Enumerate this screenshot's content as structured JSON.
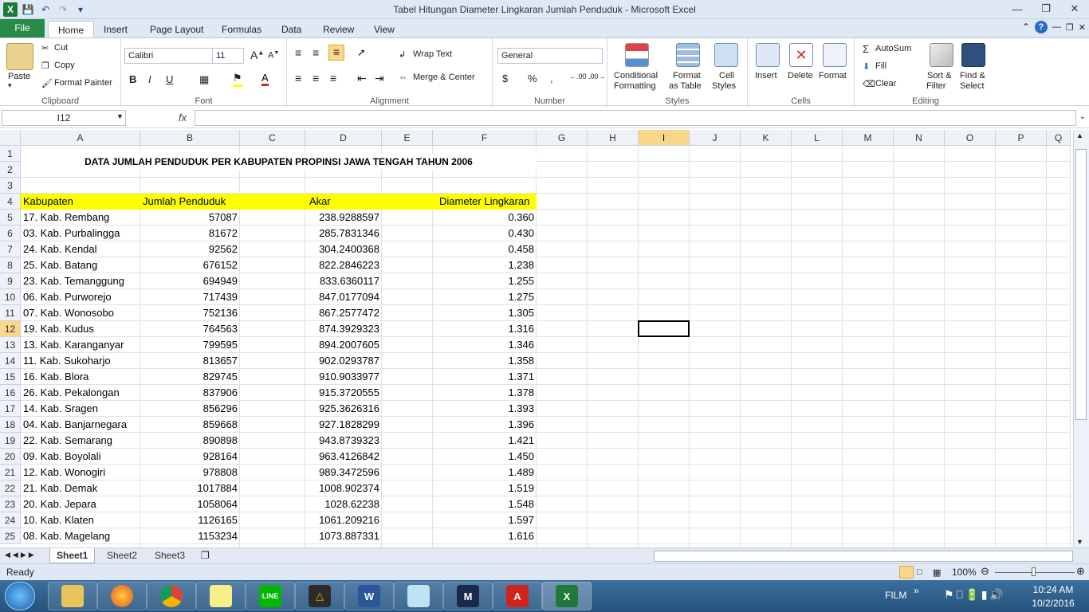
{
  "window": {
    "title": "Tabel Hitungan Diameter Lingkaran Jumlah Penduduk  -  Microsoft Excel"
  },
  "ribbon_tabs": [
    "File",
    "Home",
    "Insert",
    "Page Layout",
    "Formulas",
    "Data",
    "Review",
    "View"
  ],
  "clipboard": {
    "paste": "Paste",
    "cut": "Cut",
    "copy": "Copy",
    "format_painter": "Format Painter",
    "label": "Clipboard"
  },
  "font": {
    "name": "Calibri",
    "size": "11",
    "label": "Font"
  },
  "alignment": {
    "wrap": "Wrap Text",
    "merge": "Merge & Center",
    "label": "Alignment"
  },
  "number": {
    "format": "General",
    "label": "Number"
  },
  "styles": {
    "conditional": "Conditional",
    "conditional2": "Formatting",
    "format_table": "Format",
    "format_table2": "as Table",
    "cell_styles": "Cell",
    "cell_styles2": "Styles",
    "label": "Styles"
  },
  "cells": {
    "insert": "Insert",
    "delete": "Delete",
    "format": "Format",
    "label": "Cells"
  },
  "editing": {
    "autosum": "AutoSum",
    "fill": "Fill",
    "clear": "Clear",
    "sort": "Sort &",
    "sort2": "Filter",
    "find": "Find &",
    "find2": "Select",
    "label": "Editing"
  },
  "formula_bar": {
    "name_box": "I12",
    "fx": "fx",
    "value": ""
  },
  "columns": [
    "A",
    "B",
    "C",
    "D",
    "E",
    "F",
    "G",
    "H",
    "I",
    "J",
    "K",
    "L",
    "M",
    "N",
    "O",
    "P",
    "Q"
  ],
  "rows": [
    "1",
    "2",
    "3",
    "4",
    "5",
    "6",
    "7",
    "8",
    "9",
    "10",
    "11",
    "12",
    "13",
    "14",
    "15",
    "16",
    "17",
    "18",
    "19",
    "20",
    "21",
    "22",
    "23",
    "24",
    "25"
  ],
  "sheet": {
    "title": "DATA JUMLAH PENDUDUK PER KABUPATEN PROPINSI JAWA TENGAH TAHUN 2006",
    "headers": {
      "kabupaten": "Kabupaten",
      "jumlah": "Jumlah Penduduk",
      "akar": "Akar",
      "diameter": "Diameter Lingkaran"
    },
    "data": [
      [
        "17. Kab. Rembang",
        "57087",
        "238.9288597",
        "0.360"
      ],
      [
        "03. Kab. Purbalingga",
        "81672",
        "285.7831346",
        "0.430"
      ],
      [
        "24. Kab. Kendal",
        "92562",
        "304.2400368",
        "0.458"
      ],
      [
        "25. Kab. Batang",
        "676152",
        "822.2846223",
        "1.238"
      ],
      [
        "23. Kab. Temanggung",
        "694949",
        "833.6360117",
        "1.255"
      ],
      [
        "06. Kab. Purworejo",
        "717439",
        "847.0177094",
        "1.275"
      ],
      [
        "07. Kab. Wonosobo",
        "752136",
        "867.2577472",
        "1.305"
      ],
      [
        "19. Kab. Kudus",
        "764563",
        "874.3929323",
        "1.316"
      ],
      [
        "13. Kab. Karanganyar",
        "799595",
        "894.2007605",
        "1.346"
      ],
      [
        "11. Kab. Sukoharjo",
        "813657",
        "902.0293787",
        "1.358"
      ],
      [
        "16. Kab. Blora",
        "829745",
        "910.9033977",
        "1.371"
      ],
      [
        "26. Kab. Pekalongan",
        "837906",
        "915.3720555",
        "1.378"
      ],
      [
        "14. Kab. Sragen",
        "856296",
        "925.3626316",
        "1.393"
      ],
      [
        "04. Kab. Banjarnegara",
        "859668",
        "927.1828299",
        "1.396"
      ],
      [
        "22. Kab. Semarang",
        "890898",
        "943.8739323",
        "1.421"
      ],
      [
        "09. Kab. Boyolali",
        "928164",
        "963.4126842",
        "1.450"
      ],
      [
        "12. Kab. Wonogiri",
        "978808",
        "989.3472596",
        "1.489"
      ],
      [
        "21. Kab. Demak",
        "1017884",
        "1008.902374",
        "1.519"
      ],
      [
        "20. Kab. Jepara",
        "1058064",
        "1028.62238",
        "1.548"
      ],
      [
        "10. Kab. Klaten",
        "1126165",
        "1061.209216",
        "1.597"
      ],
      [
        "08. Kab. Magelang",
        "1153234",
        "1073.887331",
        "1.616"
      ]
    ]
  },
  "sheet_tabs": [
    "Sheet1",
    "Sheet2",
    "Sheet3"
  ],
  "status": {
    "ready": "Ready",
    "zoom": "100%"
  },
  "tray": {
    "film": "FILM",
    "time": "10:24 AM",
    "date": "10/2/2016"
  }
}
